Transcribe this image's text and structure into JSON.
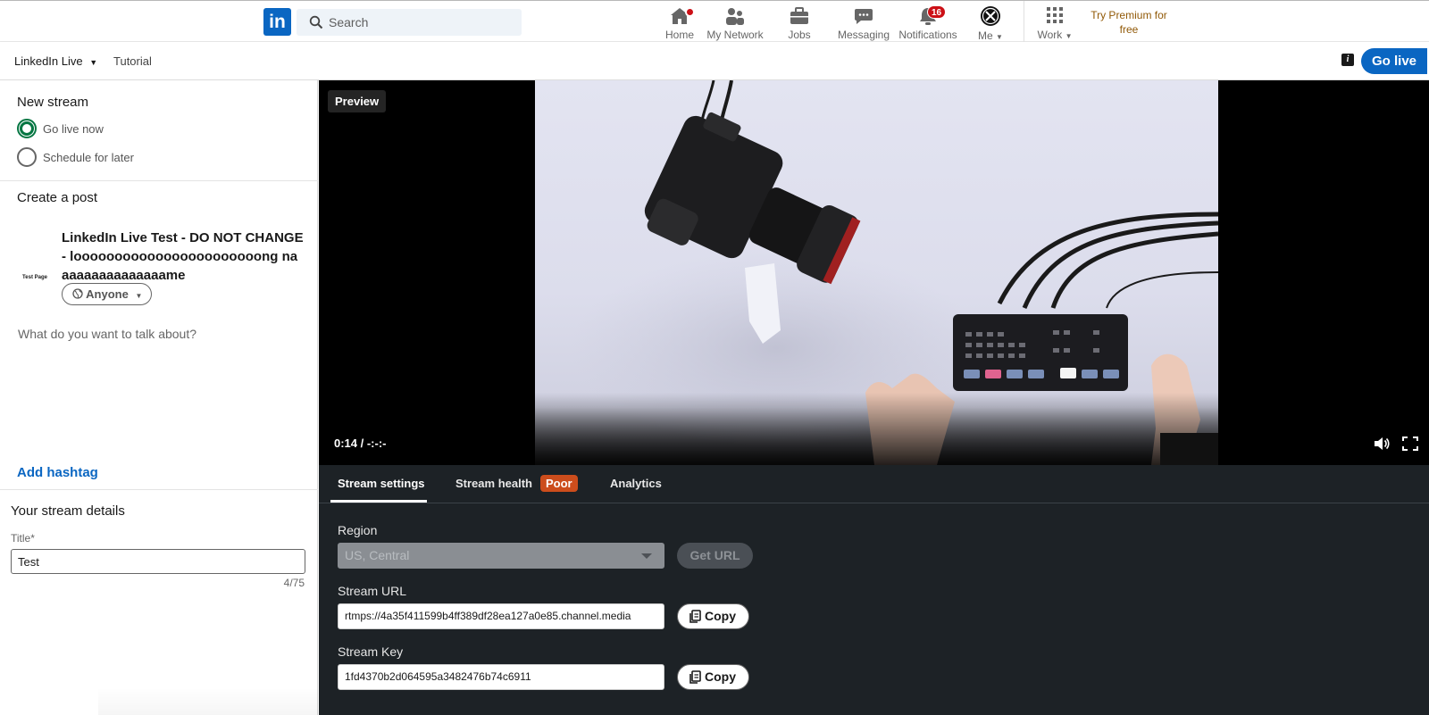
{
  "colors": {
    "brand": "#0a66c2",
    "badge": "#cc1016",
    "radio_on": "#057642",
    "poor_badge": "#cc4d1c",
    "premium": "#915907"
  },
  "logo": {
    "text": "in"
  },
  "search": {
    "placeholder": "Search"
  },
  "nav": {
    "home": {
      "label": "Home",
      "icon": "home-icon"
    },
    "network": {
      "label": "My Network",
      "icon": "people-icon"
    },
    "jobs": {
      "label": "Jobs",
      "icon": "briefcase-icon"
    },
    "messaging": {
      "label": "Messaging",
      "icon": "chat-icon"
    },
    "notifications": {
      "label": "Notifications",
      "icon": "bell-icon",
      "count": "16"
    },
    "me": {
      "label": "Me",
      "icon": "avatar-icon"
    },
    "work": {
      "label": "Work",
      "icon": "grid-icon"
    },
    "premium": "Try Premium for free"
  },
  "subnav": {
    "live": "LinkedIn Live",
    "tutorial": "Tutorial",
    "go_live": "Go live"
  },
  "left": {
    "new_stream": "New stream",
    "go_live_now": "Go live now",
    "schedule": "Schedule for later",
    "create_post": "Create a post",
    "page_avatar": "Test Page",
    "post_title": "LinkedIn Live Test - DO NOT CHANGE - looooooooooooooooooooooong naaaaaaaaaaaaaaame",
    "visibility": "Anyone",
    "talk_placeholder": "What do you want to talk about?",
    "add_hashtag": "Add hashtag",
    "details": "Your stream details",
    "title_label": "Title*",
    "title_value": "Test",
    "title_count": "4/75"
  },
  "video": {
    "preview": "Preview",
    "time": "0:14 / -:-:-"
  },
  "panel": {
    "tabs": {
      "settings": "Stream settings",
      "health": "Stream health",
      "health_status": "Poor",
      "analytics": "Analytics"
    },
    "region_label": "Region",
    "region_value": "US, Central",
    "get_url": "Get URL",
    "url_label": "Stream URL",
    "url_value": "rtmps://4a35f411599b4ff389df28ea127a0e85.channel.media",
    "key_label": "Stream Key",
    "key_value": "1fd4370b2d064595a3482476b74c6911",
    "copy": "Copy"
  }
}
